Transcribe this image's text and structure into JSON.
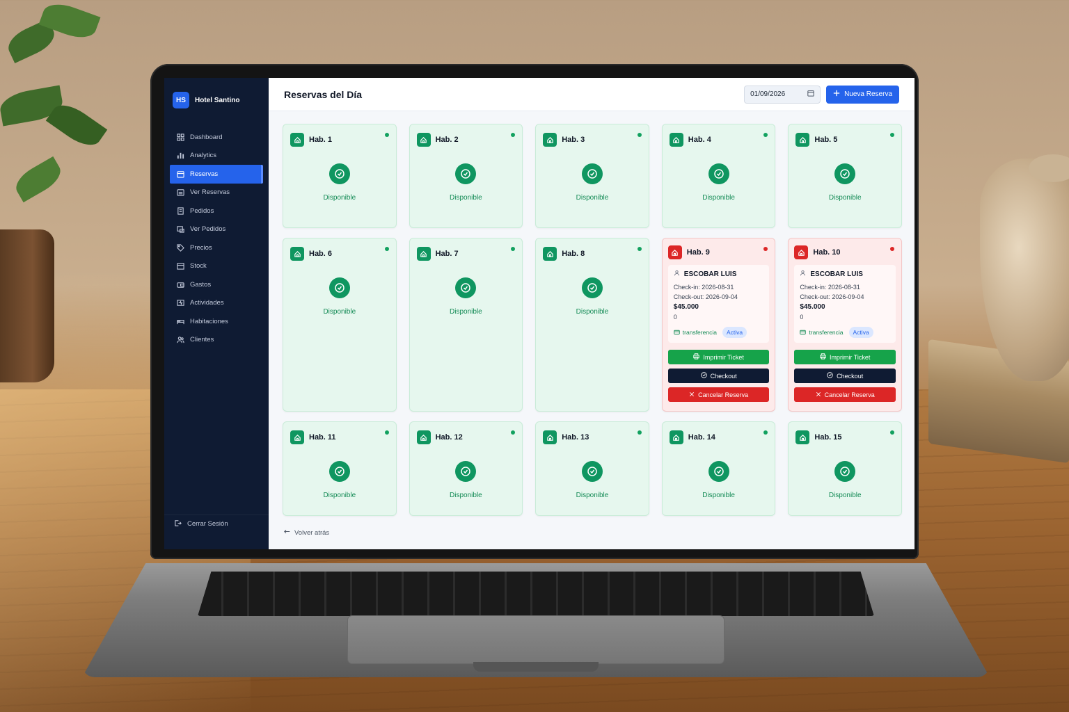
{
  "app": {
    "logo_text": "HS",
    "name": "Hotel Santino"
  },
  "sidebar": {
    "items": [
      {
        "label": "Dashboard",
        "icon": "dashboard-icon"
      },
      {
        "label": "Analytics",
        "icon": "bar-chart-icon"
      },
      {
        "label": "Reservas",
        "icon": "calendar-icon",
        "active": true
      },
      {
        "label": "Ver Reservas",
        "icon": "calendar-list-icon"
      },
      {
        "label": "Pedidos",
        "icon": "receipt-icon"
      },
      {
        "label": "Ver Pedidos",
        "icon": "receipt-view-icon"
      },
      {
        "label": "Precios",
        "icon": "tag-icon"
      },
      {
        "label": "Stock",
        "icon": "box-icon"
      },
      {
        "label": "Gastos",
        "icon": "wallet-icon"
      },
      {
        "label": "Actividades",
        "icon": "activity-icon"
      },
      {
        "label": "Habitaciones",
        "icon": "bed-icon"
      },
      {
        "label": "Clientes",
        "icon": "users-icon"
      }
    ],
    "logout_label": "Cerrar Sesión"
  },
  "header": {
    "title": "Reservas del Día",
    "date_value": "01/09/2026",
    "new_button_label": "Nueva Reserva"
  },
  "rooms": {
    "r1": {
      "name": "Hab. 1",
      "status": "Disponible"
    },
    "r2": {
      "name": "Hab. 2",
      "status": "Disponible"
    },
    "r3": {
      "name": "Hab. 3",
      "status": "Disponible"
    },
    "r4": {
      "name": "Hab. 4",
      "status": "Disponible"
    },
    "r5": {
      "name": "Hab. 5",
      "status": "Disponible"
    },
    "r6": {
      "name": "Hab. 6",
      "status": "Disponible"
    },
    "r7": {
      "name": "Hab. 7",
      "status": "Disponible"
    },
    "r8": {
      "name": "Hab. 8",
      "status": "Disponible"
    },
    "r9": {
      "name": "Hab. 9",
      "guest": "ESCOBAR LUIS",
      "checkin": "Check-in: 2026-08-31",
      "checkout": "Check-out: 2026-09-04",
      "price": "$45.000",
      "extra": "0",
      "payment": "transferencia",
      "state": "Activa"
    },
    "r10": {
      "name": "Hab. 10",
      "guest": "ESCOBAR LUIS",
      "checkin": "Check-in: 2026-08-31",
      "checkout": "Check-out: 2026-09-04",
      "price": "$45.000",
      "extra": "0",
      "payment": "transferencia",
      "state": "Activa"
    },
    "r11": {
      "name": "Hab. 11",
      "status": "Disponible"
    },
    "r12": {
      "name": "Hab. 12",
      "status": "Disponible"
    },
    "r13": {
      "name": "Hab. 13",
      "status": "Disponible"
    },
    "r14": {
      "name": "Hab. 14",
      "status": "Disponible"
    },
    "r15": {
      "name": "Hab. 15",
      "status": "Disponible"
    }
  },
  "actions": {
    "print": "Imprimir Ticket",
    "checkout": "Checkout",
    "cancel": "Cancelar Reserva"
  },
  "footer": {
    "back_label": "Volver atrás"
  },
  "colors": {
    "accent": "#2563eb",
    "available": "#0f9660",
    "occupied": "#dc2626",
    "sidebar_bg": "#0f1b33"
  }
}
